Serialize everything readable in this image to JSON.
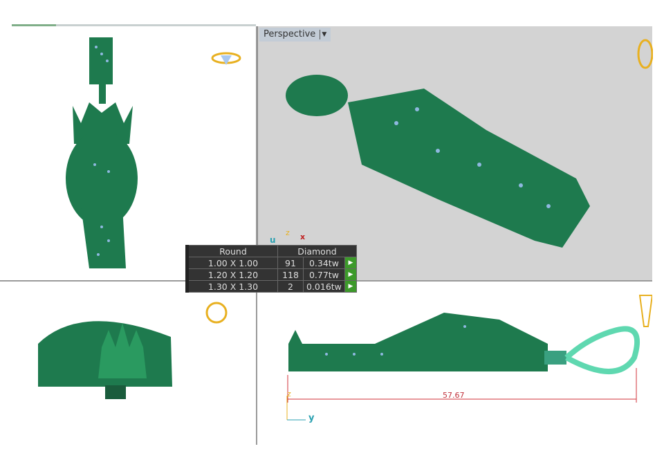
{
  "viewports": {
    "perspective_label": "Perspective",
    "perspective_dropdown_icon": "chevron-down-icon"
  },
  "stone_table": {
    "headers": [
      "Round",
      "Diamond"
    ],
    "rows": [
      {
        "size": "1.00 X 1.00",
        "count": "91",
        "weight": "0.34tw"
      },
      {
        "size": "1.20 X 1.20",
        "count": "118",
        "weight": "0.77tw"
      },
      {
        "size": "1.30 X 1.30",
        "count": "2",
        "weight": "0.016tw"
      }
    ]
  },
  "dimension": {
    "value": "57.67"
  },
  "axes": {
    "x": "x",
    "y": "y",
    "z": "z",
    "u": "u"
  },
  "colors": {
    "model": "#1e7a4e",
    "stone": "#8fb8e0",
    "bail": "#5fd8b0",
    "dimension": "#d0303a",
    "viewport_bg": "#d3d3d3"
  }
}
